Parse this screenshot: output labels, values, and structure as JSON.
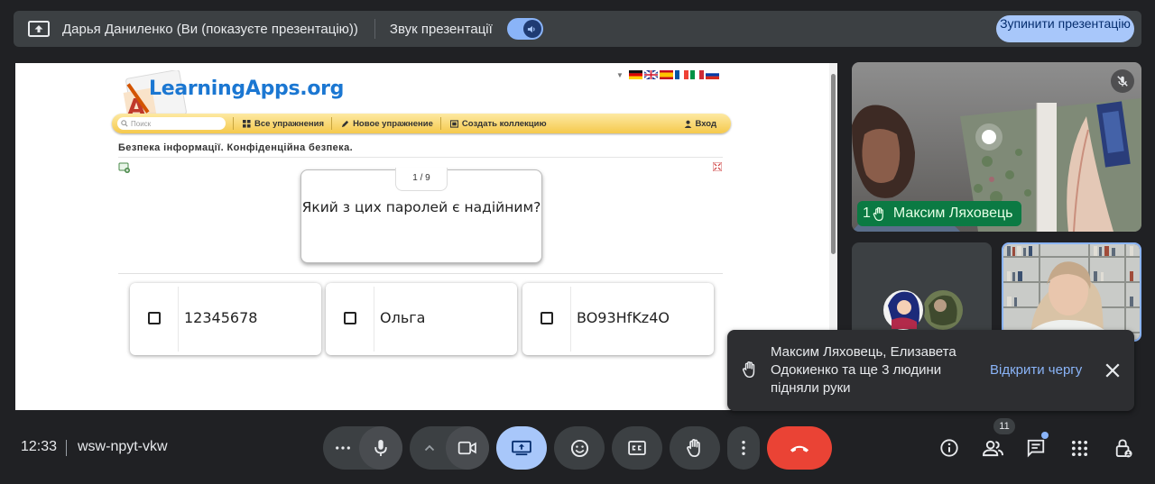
{
  "presenting_bar": {
    "presenter_text": "Дарья Даниленко (Ви (показуєте презентацію))",
    "sound_label": "Звук презентації",
    "stop_button": "Зупинити презентацію"
  },
  "shared_screen": {
    "site_logo": "LearningApps.org",
    "search_placeholder": "Поиск",
    "nav": {
      "all_exercises": "Все упражнения",
      "new_exercise": "Новое упражнение",
      "create_collection": "Создать коллекцию",
      "login": "Вход"
    },
    "exercise_title": "Безпека інформації. Конфіденційна безпека.",
    "counter": "1 / 9",
    "question": "Який з цих паролей є надійним?",
    "answers": [
      "12345678",
      "Ольга",
      "BO93HfKz4O"
    ]
  },
  "participants": {
    "main_tile_name": "Максим Ляховець",
    "main_tile_hand_count": "1"
  },
  "notification": {
    "message": "Максим Ляховець, Елизавета Одокиенко та ще 3 людини підняли руки",
    "open_queue": "Відкрити чергу"
  },
  "bottom_bar": {
    "time": "12:33",
    "meeting_code": "wsw-npyt-vkw",
    "participant_count": "11"
  },
  "colors": {
    "background": "#202124",
    "accent_blue": "#a8c7fa",
    "end_call_red": "#ea4335",
    "name_chip_green": "#0b7a43"
  }
}
